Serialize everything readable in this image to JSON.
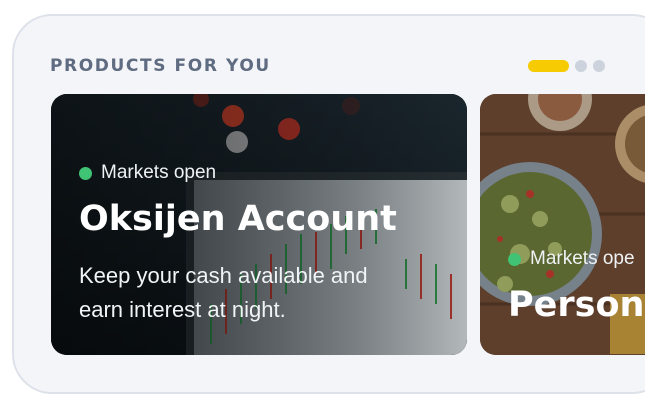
{
  "section": {
    "heading": "PRODUCTS FOR YOU"
  },
  "pager": {
    "count": 3,
    "active_index": 0,
    "active_color": "#f6cb02",
    "inactive_color": "#cdd3dd"
  },
  "cards": [
    {
      "status": "Markets open",
      "status_color": "#40c374",
      "title": "Oksijen Account",
      "description": "Keep your cash available and earn interest at night.",
      "image": "stock-chart-photo"
    },
    {
      "status": "Markets ope",
      "status_color": "#40c374",
      "title": "Person",
      "image": "food-table-photo"
    }
  ]
}
